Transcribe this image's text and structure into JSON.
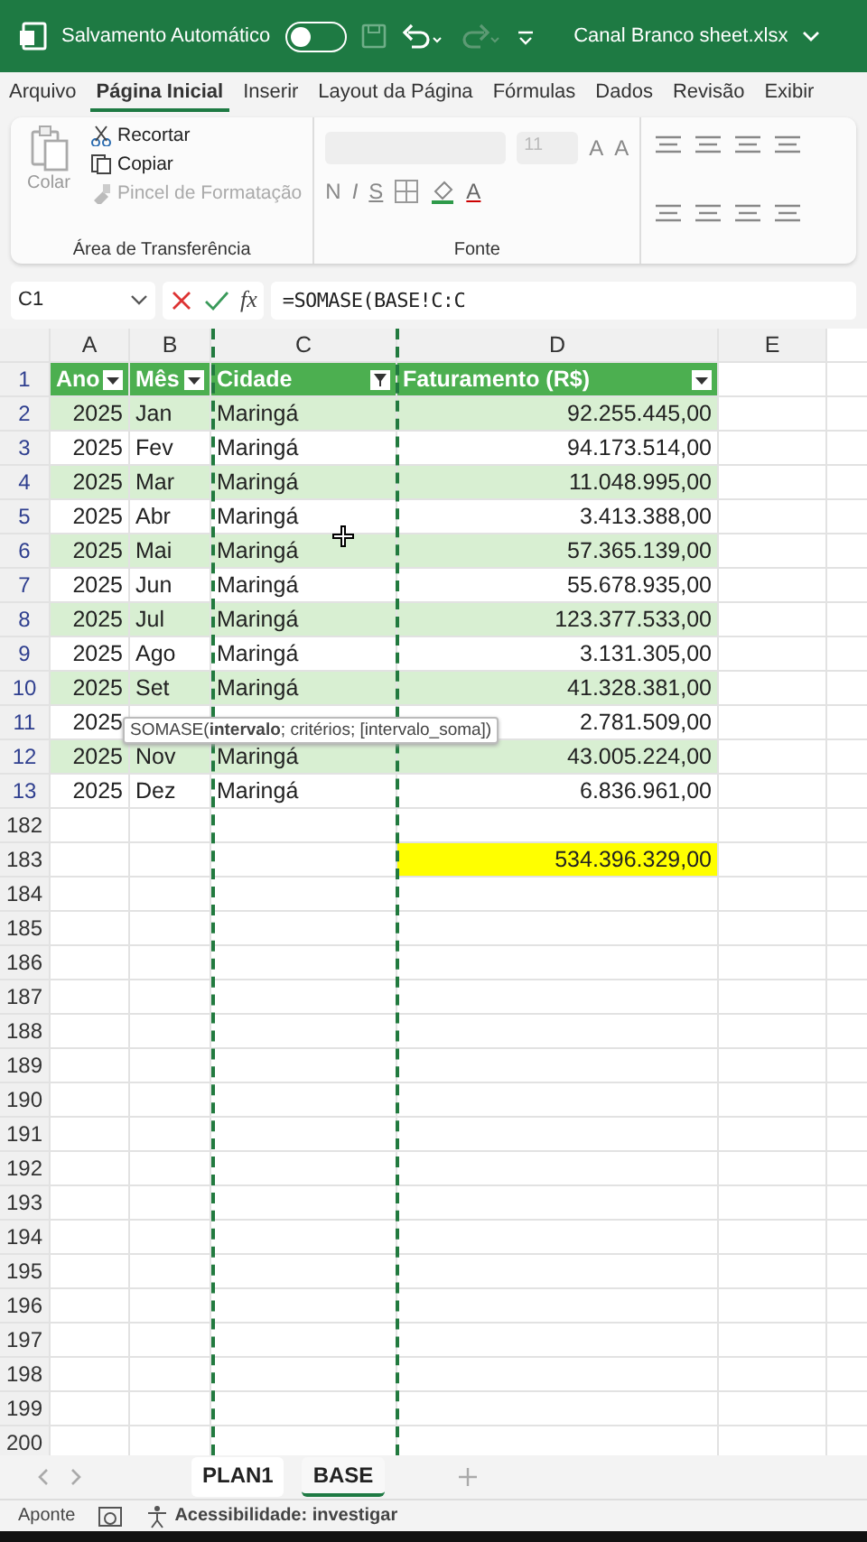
{
  "title_bar": {
    "autosave_label": "Salvamento Automático",
    "autosave_on": false,
    "file_name": "Canal Branco sheet.xlsx"
  },
  "ribbon_tabs": [
    {
      "label": "Arquivo",
      "selected": false
    },
    {
      "label": "Página Inicial",
      "selected": true
    },
    {
      "label": "Inserir",
      "selected": false
    },
    {
      "label": "Layout da Página",
      "selected": false
    },
    {
      "label": "Fórmulas",
      "selected": false
    },
    {
      "label": "Dados",
      "selected": false
    },
    {
      "label": "Revisão",
      "selected": false
    },
    {
      "label": "Exibir",
      "selected": false
    }
  ],
  "clipboard": {
    "paste": "Colar",
    "cut": "Recortar",
    "copy": "Copiar",
    "format_painter": "Pincel de Formatação",
    "label": "Área de Transferência"
  },
  "font_group": {
    "size": "11",
    "grow": "A",
    "shrink": "A",
    "styles": [
      "N",
      "I",
      "S"
    ],
    "color_button": "A",
    "label": "Fonte"
  },
  "formula_bar": {
    "name_box": "C1",
    "fx": "fx",
    "formula": "=SOMASE(BASE!C:C"
  },
  "columns": [
    "A",
    "B",
    "C",
    "D",
    "E"
  ],
  "header_row": {
    "number": "1",
    "cells": [
      {
        "label": "Ano",
        "filtered": false
      },
      {
        "label": "Mês",
        "filtered": false
      },
      {
        "label": "Cidade",
        "filtered": true
      },
      {
        "label": "Faturamento (R$)",
        "filtered": false
      }
    ]
  },
  "rows": [
    {
      "number": "2",
      "year": "2025",
      "month": "Jan",
      "city": "Maringá",
      "revenue": "92.255.445,00"
    },
    {
      "number": "3",
      "year": "2025",
      "month": "Fev",
      "city": "Maringá",
      "revenue": "94.173.514,00"
    },
    {
      "number": "4",
      "year": "2025",
      "month": "Mar",
      "city": "Maringá",
      "revenue": "11.048.995,00"
    },
    {
      "number": "5",
      "year": "2025",
      "month": "Abr",
      "city": "Maringá",
      "revenue": "3.413.388,00"
    },
    {
      "number": "6",
      "year": "2025",
      "month": "Mai",
      "city": "Maringá",
      "revenue": "57.365.139,00"
    },
    {
      "number": "7",
      "year": "2025",
      "month": "Jun",
      "city": "Maringá",
      "revenue": "55.678.935,00"
    },
    {
      "number": "8",
      "year": "2025",
      "month": "Jul",
      "city": "Maringá",
      "revenue": "123.377.533,00"
    },
    {
      "number": "9",
      "year": "2025",
      "month": "Ago",
      "city": "Maringá",
      "revenue": "3.131.305,00"
    },
    {
      "number": "10",
      "year": "2025",
      "month": "Set",
      "city": "Maringá",
      "revenue": "41.328.381,00"
    },
    {
      "number": "11",
      "year": "2025",
      "revenue": "2.781.509,00"
    },
    {
      "number": "12",
      "year": "2025",
      "month": "Nov",
      "city": "Maringá",
      "revenue": "43.005.224,00"
    },
    {
      "number": "13",
      "year": "2025",
      "month": "Dez",
      "city": "Maringá",
      "revenue": "6.836.961,00"
    }
  ],
  "tooltip": "SOMASE(**intervalo**; critérios; [intervalo_soma])",
  "lower_rows": [
    {
      "number": "182"
    },
    {
      "number": "183",
      "total": "534.396.329,00"
    },
    {
      "number": "184"
    },
    {
      "number": "185"
    },
    {
      "number": "186"
    },
    {
      "number": "187"
    },
    {
      "number": "188"
    },
    {
      "number": "189"
    },
    {
      "number": "190"
    },
    {
      "number": "191"
    },
    {
      "number": "192"
    },
    {
      "number": "193"
    },
    {
      "number": "194"
    },
    {
      "number": "195"
    },
    {
      "number": "196"
    },
    {
      "number": "197"
    },
    {
      "number": "198"
    },
    {
      "number": "199"
    },
    {
      "number": "200"
    }
  ],
  "sheet_tabs": [
    {
      "label": "PLAN1",
      "selected": false
    },
    {
      "label": "BASE",
      "selected": true
    }
  ],
  "status_bar": {
    "mode": "Aponte",
    "accessibility": "Acessibilidade: investigar"
  }
}
